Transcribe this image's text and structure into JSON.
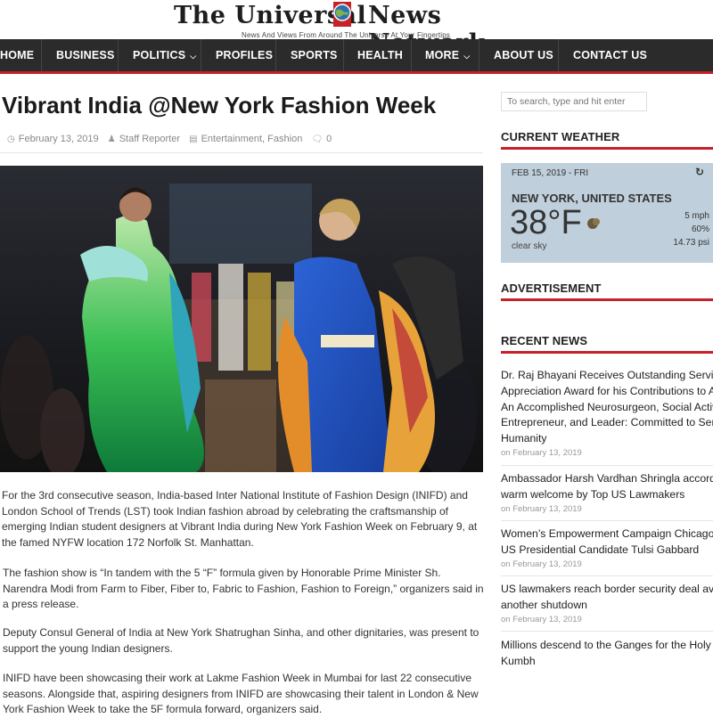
{
  "site": {
    "logo_left": "The Universal",
    "logo_right": "News Network",
    "tagline": "News And Views From Around The Universe At Your Fingertips"
  },
  "nav": {
    "items": [
      {
        "label": "HOME"
      },
      {
        "label": "BUSINESS"
      },
      {
        "label": "POLITICS",
        "dropdown": true
      },
      {
        "label": "PROFILES"
      },
      {
        "label": "SPORTS"
      },
      {
        "label": "HEALTH"
      },
      {
        "label": "MORE",
        "dropdown": true
      },
      {
        "label": "ABOUT US"
      },
      {
        "label": "CONTACT US"
      }
    ]
  },
  "article": {
    "title": "Vibrant India @New York Fashion Week",
    "date": "February 13, 2019",
    "author": "Staff Reporter",
    "categories": "Entertainment, Fashion",
    "comments": "0",
    "paragraphs": [
      "For the 3rd consecutive season, India-based Inter National Institute of Fashion Design (INIFD) and London School of Trends (LST) took Indian fashion abroad by celebrating the craftsmanship of emerging Indian student designers at Vibrant India during New York Fashion Week on February 9, at the famed NYFW location 172 Norfolk St. Manhattan.",
      "The fashion show is “In tandem with the 5 “F” formula given by Honorable Prime Minister Sh. Narendra Modi from Farm to Fiber, Fiber to, Fabric to Fashion, Fashion to Foreign,” organizers said in a press release.",
      "Deputy Consul General of India at New York Shatrughan Sinha, and other dignitaries, was present to support the young Indian designers.",
      "INIFD have been showcasing their work at Lakme Fashion Week in Mumbai for last 22 consecutive seasons. Alongside that, aspiring designers from INIFD are showcasing their talent in London & New York Fashion Week to take the 5F formula forward, organizers said."
    ]
  },
  "sidebar": {
    "search_placeholder": "To search, type and hit enter",
    "weather_heading": "CURRENT WEATHER",
    "weather": {
      "date": "FEB 15, 2019 - FRI",
      "location": "NEW YORK, UNITED STATES",
      "temp": "38°F",
      "description": "clear sky",
      "wind": "5 mph",
      "humidity": "60%",
      "pressure": "14.73 psi"
    },
    "ad_heading": "ADVERTISEMENT",
    "recent_heading": "RECENT NEWS",
    "recent": [
      {
        "title_lines": [
          "Dr. Raj Bhayani Receives Outstanding Service",
          "Appreciation Award for his Contributions to A",
          "An Accomplished Neurosurgeon, Social Activis",
          "Entrepreneur, and Leader: Committed to Serv",
          "Humanity"
        ],
        "date": "on February 13, 2019"
      },
      {
        "title_lines": [
          "Ambassador Harsh Vardhan Shringla accorded",
          "warm welcome by Top US Lawmakers"
        ],
        "date": "on February 13, 2019"
      },
      {
        "title_lines": [
          "Women’s Empowerment Campaign Chicago H",
          "US Presidential Candidate Tulsi Gabbard"
        ],
        "date": "on February 13, 2019"
      },
      {
        "title_lines": [
          "US lawmakers reach border security deal aver",
          "another shutdown"
        ],
        "date": "on February 13, 2019"
      },
      {
        "title_lines": [
          "Millions descend to the Ganges for the Holy D",
          "Kumbh"
        ],
        "date": ""
      }
    ]
  }
}
